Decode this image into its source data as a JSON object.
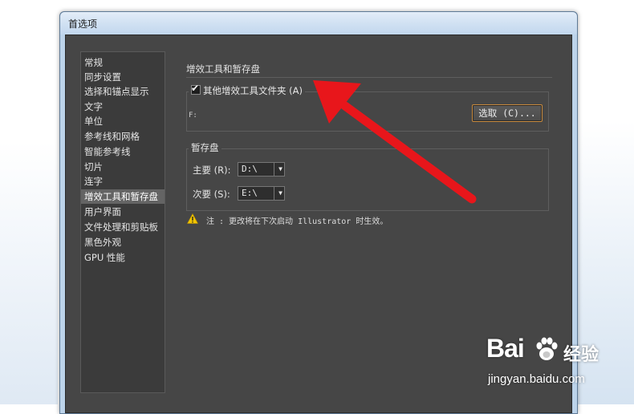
{
  "window": {
    "title": "首选项"
  },
  "sidebar": {
    "items": [
      {
        "label": "常规"
      },
      {
        "label": "同步设置"
      },
      {
        "label": "选择和锚点显示"
      },
      {
        "label": "文字"
      },
      {
        "label": "单位"
      },
      {
        "label": "参考线和网格"
      },
      {
        "label": "智能参考线"
      },
      {
        "label": "切片"
      },
      {
        "label": "连字"
      },
      {
        "label": "增效工具和暂存盘",
        "selected": true
      },
      {
        "label": "用户界面"
      },
      {
        "label": "文件处理和剪贴板"
      },
      {
        "label": "黑色外观"
      },
      {
        "label": "GPU 性能"
      }
    ]
  },
  "main": {
    "section_title": "增效工具和暂存盘",
    "plugins_group": {
      "checkbox_label": "其他增效工具文件夹 (A)",
      "checked": true,
      "path": "F:",
      "choose_button": "选取 (C)..."
    },
    "scratch_group": {
      "title": "暂存盘",
      "primary_label": "主要 (R):",
      "primary_value": "D:\\",
      "secondary_label": "次要 (S):",
      "secondary_value": "E:\\"
    },
    "note": "注 : 更改将在下次启动 Illustrator 时生效。"
  },
  "colors": {
    "panel_bg": "#464646",
    "selected_item": "#646464",
    "button_border": "#c88a3e",
    "annotation_arrow": "#e8161b",
    "warning_yellow": "#f2c500"
  },
  "watermark": {
    "brand": "Bai",
    "brand_cn": "经验",
    "url": "jingyan.baidu.com"
  }
}
